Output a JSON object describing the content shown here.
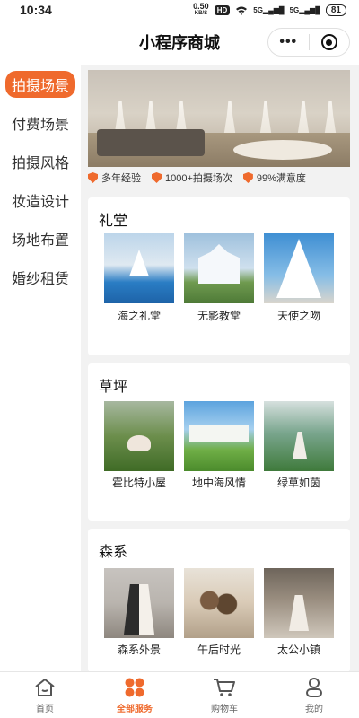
{
  "status_bar": {
    "time": "10:34",
    "net_speed": "0.50",
    "net_unit": "KB/S",
    "hd_label": "HD",
    "signal_1": "5G",
    "signal_2": "5G",
    "battery": "81"
  },
  "nav": {
    "title": "小程序商城",
    "menu_icon": "more-dots-icon",
    "close_icon": "target-circle-icon"
  },
  "sidebar": {
    "items": [
      {
        "label": "拍摄场景",
        "active": true
      },
      {
        "label": "付费场景",
        "active": false
      },
      {
        "label": "拍摄风格",
        "active": false
      },
      {
        "label": "妆造设计",
        "active": false
      },
      {
        "label": "场地布置",
        "active": false
      },
      {
        "label": "婚纱租赁",
        "active": false
      }
    ]
  },
  "badges": [
    {
      "icon": "check-shield-icon",
      "text": "多年经验"
    },
    {
      "icon": "check-shield-icon",
      "text": "1000+拍摄场次"
    },
    {
      "icon": "check-shield-icon",
      "text": "99%满意度"
    }
  ],
  "sections": [
    {
      "title": "礼堂",
      "items": [
        {
          "label": "海之礼堂",
          "image": "sea-chapel-photo"
        },
        {
          "label": "无影教堂",
          "image": "glass-church-photo"
        },
        {
          "label": "天使之吻",
          "image": "angel-kiss-photo"
        }
      ]
    },
    {
      "title": "草坪",
      "items": [
        {
          "label": "霍比特小屋",
          "image": "hobbit-house-photo"
        },
        {
          "label": "地中海风情",
          "image": "mediterranean-photo"
        },
        {
          "label": "绿草如茵",
          "image": "green-lawn-photo"
        }
      ]
    },
    {
      "title": "森系",
      "items": [
        {
          "label": "森系外景",
          "image": "forest-outdoor-photo"
        },
        {
          "label": "午后时光",
          "image": "afternoon-photo"
        },
        {
          "label": "太公小镇",
          "image": "taigong-town-photo"
        }
      ]
    }
  ],
  "tabbar": {
    "tabs": [
      {
        "label": "首页",
        "icon": "home-icon",
        "active": false
      },
      {
        "label": "全部服务",
        "icon": "grid-services-icon",
        "active": true
      },
      {
        "label": "购物车",
        "icon": "cart-icon",
        "active": false
      },
      {
        "label": "我的",
        "icon": "user-icon",
        "active": false
      }
    ]
  },
  "colors": {
    "accent": "#ef6a2d",
    "background": "#f2f2f2",
    "card": "#ffffff"
  }
}
